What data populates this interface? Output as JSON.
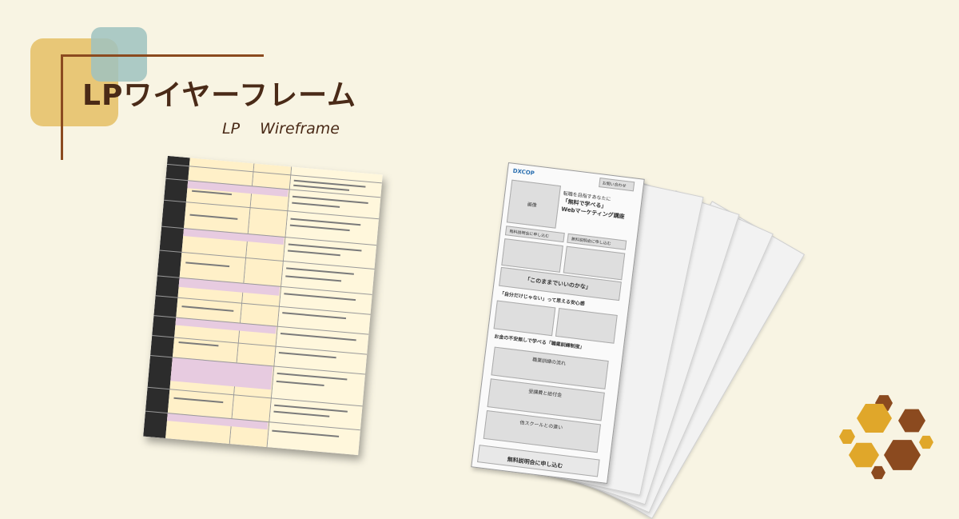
{
  "header": {
    "title": "LPワイヤーフレーム",
    "subtitle": "LP　 Wireframe"
  },
  "wireframe": {
    "logo": "DXCOP",
    "menu_label": "お問い合わせ",
    "hero_line1": "転職を目指すあなたに",
    "hero_line2": "「無料で学べる」",
    "hero_line3": "Webマーケティング講座",
    "image_label": "画像",
    "cta_label": "無料説明会に申し込む",
    "section1": "「このままでいいのかな」",
    "section2": "「自分だけじゃない」って思える安心感",
    "section3": "お金の不安無しで学べる「職業訓練制度」",
    "block1": "職業訓練の流れ",
    "block2": "受講費と給付金",
    "block3": "他スクールとの違い",
    "footer_cta": "無料説明会に申し込む"
  },
  "colors": {
    "background": "#f8f4e3",
    "brand_brown": "#8b4a1f",
    "accent_yellow": "#e6c26a",
    "accent_teal": "#9fc2c0",
    "hex_gold": "#e0a72a",
    "hex_brown": "#8b4a1f"
  }
}
